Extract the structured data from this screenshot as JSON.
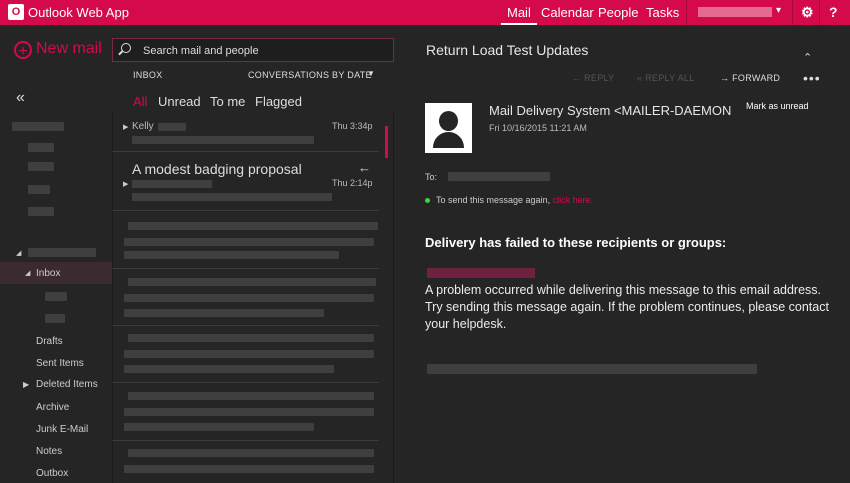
{
  "app": {
    "title": "Outlook Web App",
    "logo_glyph": "O"
  },
  "nav": {
    "items": [
      {
        "label": "Mail"
      },
      {
        "label": "Calendar"
      },
      {
        "label": "People"
      },
      {
        "label": "Tasks"
      }
    ]
  },
  "toolbar": {
    "user_chevron": "▾",
    "settings_icon": "⚙",
    "help_icon": "?"
  },
  "left": {
    "new_mail_label": "New mail",
    "collapse_icon": "«",
    "folders": {
      "inbox": "Inbox",
      "drafts": "Drafts",
      "sent": "Sent Items",
      "deleted": "Deleted Items",
      "archive": "Archive",
      "junk": "Junk E-Mail",
      "notes": "Notes",
      "outbox": "Outbox"
    }
  },
  "search": {
    "placeholder": "Search mail and people"
  },
  "list": {
    "folder_label": "INBOX",
    "sort_label": "CONVERSATIONS BY DATE",
    "sort_chevron": "▼",
    "filters": [
      {
        "label": "All"
      },
      {
        "label": "Unread"
      },
      {
        "label": "To me"
      },
      {
        "label": "Flagged"
      }
    ],
    "messages": [
      {
        "from": "Kelly",
        "subject": "",
        "date": "Thu 3:34p"
      },
      {
        "from": "",
        "subject": "A modest badging proposal",
        "date": "Thu 2:14p"
      }
    ]
  },
  "reading": {
    "subject": "Return Load Test Updates",
    "actions": {
      "reply": "REPLY",
      "reply_all": "REPLY ALL",
      "forward": "FORWARD",
      "more": "•••"
    },
    "sender": "Mail Delivery System <MAILER-DAEMON",
    "date": "Fri 10/16/2015 11:21 AM",
    "mark_unread": "Mark as unread",
    "to_label": "To:",
    "resend_text": "To send this message again, ",
    "resend_link": "click here.",
    "failure_heading": "Delivery has failed to these recipients or groups:",
    "problem_text": "A problem occurred while delivering this message to this email address. Try sending this message again. If the problem continues, please contact your helpdesk."
  },
  "colors": {
    "accent": "#d40a4a",
    "background": "#252525",
    "success": "#3fd13f"
  }
}
